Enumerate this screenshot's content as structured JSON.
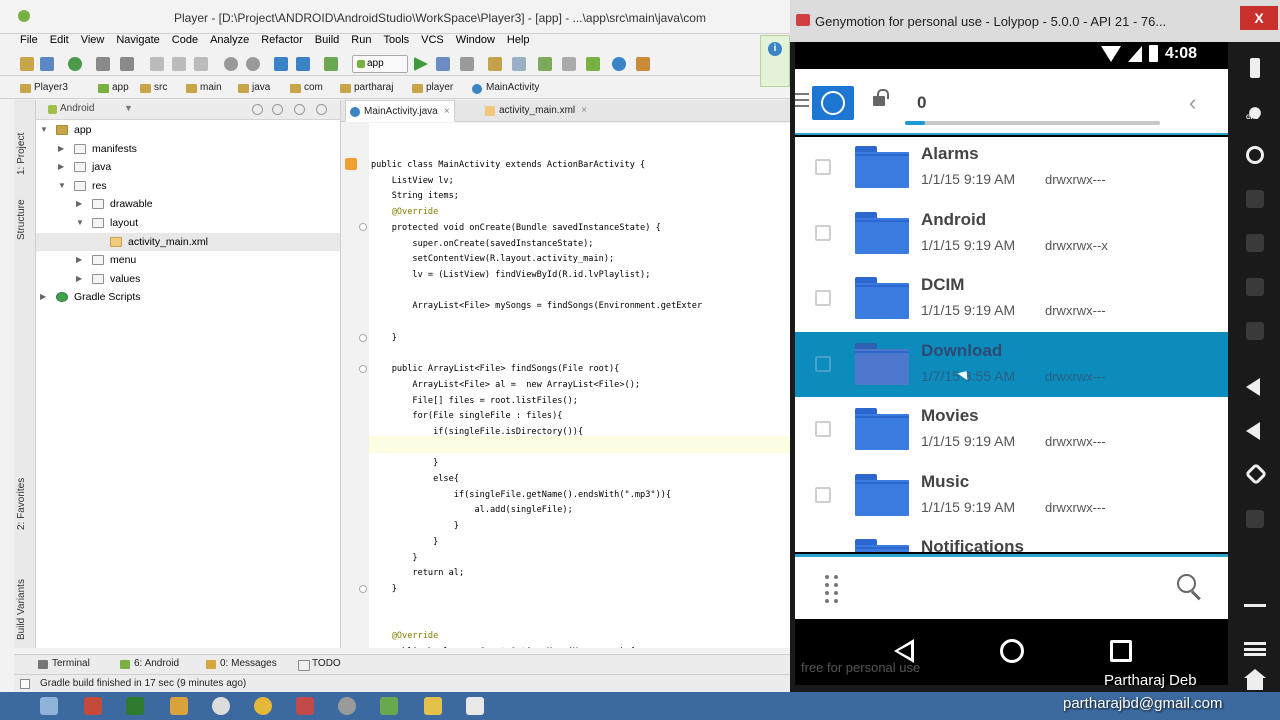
{
  "studio": {
    "title": "Player - [D:\\Project\\ANDROID\\AndroidStudio\\WorkSpace\\Player3] - [app] - ...\\app\\src\\main\\java\\com",
    "menu": [
      "File",
      "Edit",
      "View",
      "Navigate",
      "Code",
      "Analyze",
      "Refactor",
      "Build",
      "Run",
      "Tools",
      "VCS",
      "Window",
      "Help"
    ],
    "run_config": "app",
    "breadcrumbs": [
      "Player3",
      "app",
      "src",
      "main",
      "java",
      "com",
      "partharaj",
      "player",
      "MainActivity"
    ],
    "side_tabs": [
      "1: Project",
      "Structure",
      "2: Favorites",
      "Build Variants"
    ],
    "project_view": "Android",
    "tree": [
      {
        "label": "app",
        "depth": 0,
        "open": true,
        "icon": "module"
      },
      {
        "label": "manifests",
        "depth": 1,
        "open": false,
        "icon": "folder"
      },
      {
        "label": "java",
        "depth": 1,
        "open": false,
        "icon": "folder"
      },
      {
        "label": "res",
        "depth": 1,
        "open": true,
        "icon": "folder"
      },
      {
        "label": "drawable",
        "depth": 2,
        "open": false,
        "icon": "folder"
      },
      {
        "label": "layout",
        "depth": 2,
        "open": true,
        "icon": "folder"
      },
      {
        "label": "activity_main.xml",
        "depth": 3,
        "open": null,
        "icon": "xml",
        "selected": true
      },
      {
        "label": "menu",
        "depth": 2,
        "open": false,
        "icon": "folder"
      },
      {
        "label": "values",
        "depth": 2,
        "open": false,
        "icon": "folder"
      },
      {
        "label": "Gradle Scripts",
        "depth": 0,
        "open": false,
        "icon": "gradle"
      }
    ],
    "tabs": [
      {
        "label": "MainActivity.java",
        "active": true,
        "type": "java"
      },
      {
        "label": "activity_main.xml",
        "active": false,
        "type": "xml"
      }
    ],
    "code": [
      "public class MainActivity extends ActionBarActivity {",
      "    ListView lv;",
      "    String items;",
      "    @Override",
      "    protected void onCreate(Bundle savedInstanceState) {",
      "        super.onCreate(savedInstanceState);",
      "        setContentView(R.layout.activity_main);",
      "        lv = (ListView) findViewById(R.id.lvPlaylist);",
      "",
      "        ArrayList<File> mySongs = findSongs(Environment.getExter",
      "",
      "    }",
      "",
      "    public ArrayList<File> findSongs(File root){",
      "        ArrayList<File> al =  new ArrayList<File>();",
      "        File[] files = root.listFiles();",
      "        for(File singleFile : files){",
      "            if(singleFile.isDirectory()){",
      "",
      "            }",
      "            else{",
      "                if(singleFile.getName().endsWith(\".mp3\")){",
      "                    al.add(singleFile);",
      "                }",
      "            }",
      "        }",
      "        return al;",
      "    }",
      "",
      "",
      "    @Override",
      "    public boolean onCreateOptionsMenu(Menu menu) {"
    ],
    "bottom_tabs": [
      "Terminal",
      "6: Android",
      "0: Messages",
      "TODO"
    ],
    "status": "Gradle build finished in 17 sec (9 minutes ago)"
  },
  "genymotion": {
    "title": "Genymotion for personal use - Lolypop - 5.0.0 - API 21 - 76...",
    "close_label": "X",
    "status_time": "4:08",
    "selected_count": "0",
    "selection_progress": 0.08,
    "files": [
      {
        "name": "Alarms",
        "date": "1/1/15 9:19 AM",
        "perm": "drwxrwx---",
        "selected": false
      },
      {
        "name": "Android",
        "date": "1/1/15 9:19 AM",
        "perm": "drwxrwx--x",
        "selected": false
      },
      {
        "name": "DCIM",
        "date": "1/1/15 9:19 AM",
        "perm": "drwxrwx---",
        "selected": false
      },
      {
        "name": "Download",
        "date": "1/7/15 3:55 AM",
        "perm": "drwxrwx---",
        "selected": true
      },
      {
        "name": "Movies",
        "date": "1/1/15 9:19 AM",
        "perm": "drwxrwx---",
        "selected": false
      },
      {
        "name": "Music",
        "date": "1/1/15 9:19 AM",
        "perm": "drwxrwx---",
        "selected": false
      },
      {
        "name": "Notifications",
        "date": "",
        "perm": "",
        "selected": false
      }
    ],
    "free_text": "free for personal use"
  },
  "watermark": {
    "name": "Partharaj Deb",
    "email": "partharajbd@gmail.com"
  },
  "colors": {
    "selected_row": "#0b8cbd",
    "folder": "#3a7be0",
    "accent": "#2aa3cf",
    "select_button": "#1d76d2"
  }
}
